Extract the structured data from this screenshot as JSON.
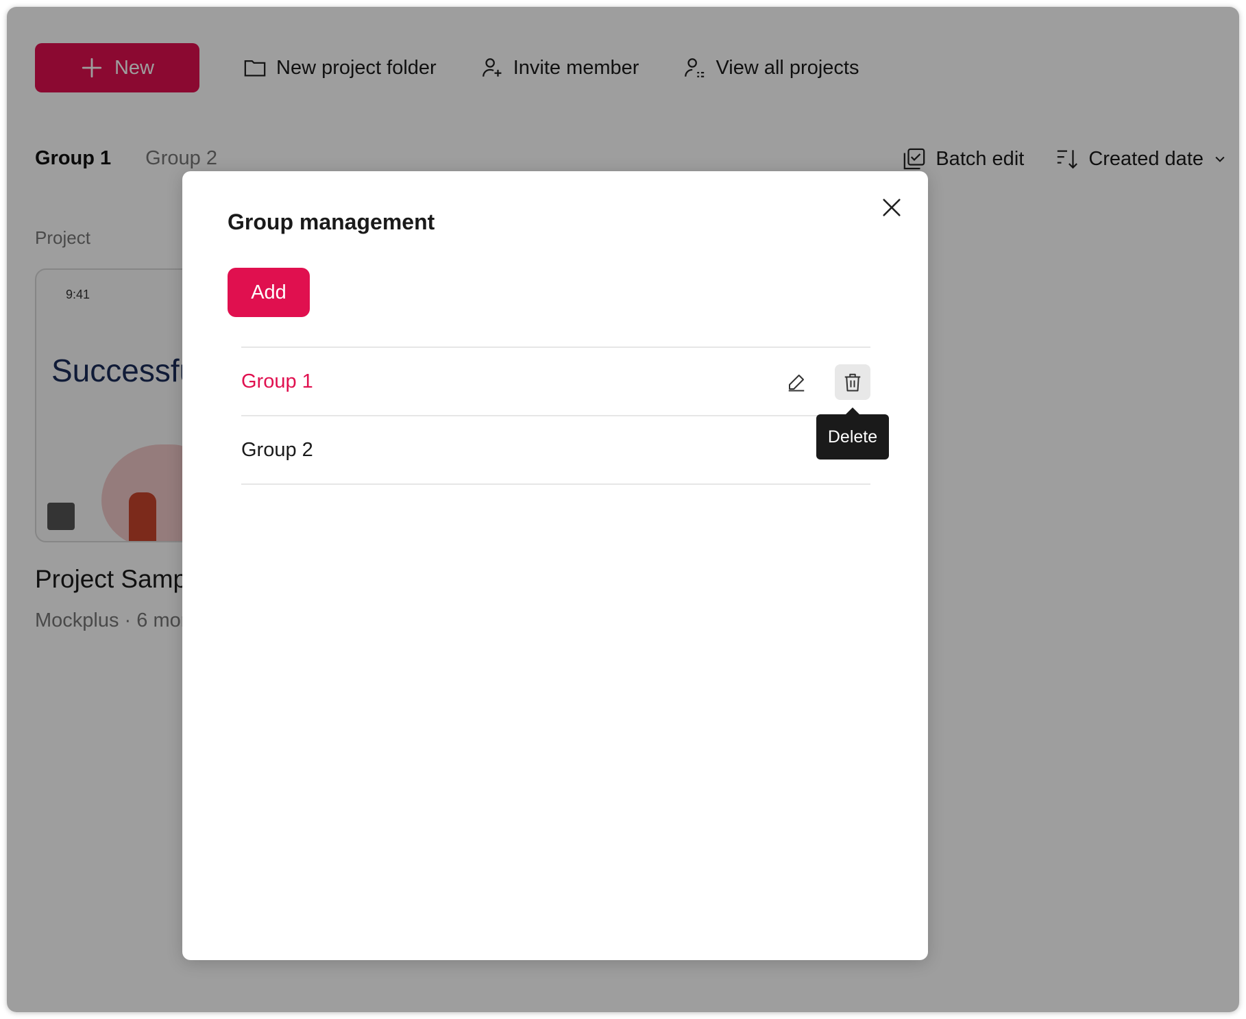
{
  "colors": {
    "accent": "#e0104f",
    "overlay": "rgba(0,0,0,0.38)",
    "tooltip_bg": "#1a1a1a"
  },
  "toolbar": {
    "new_label": "New",
    "items": [
      {
        "label": "New project folder",
        "icon": "folder-icon"
      },
      {
        "label": "Invite member",
        "icon": "user-add-icon"
      },
      {
        "label": "View all projects",
        "icon": "user-list-icon"
      }
    ]
  },
  "tabs": [
    {
      "label": "Group 1",
      "active": true
    },
    {
      "label": "Group 2",
      "active": false
    }
  ],
  "right_tools": {
    "batch_edit": "Batch edit",
    "sort_label": "Created date"
  },
  "section_label": "Project",
  "card": {
    "time": "9:41",
    "hero_text": "Successfu",
    "title": "Project Samp",
    "meta": "Mockplus · 6 mor"
  },
  "modal": {
    "title": "Group management",
    "add_label": "Add",
    "groups": [
      {
        "label": "Group 1",
        "active": true
      },
      {
        "label": "Group 2",
        "active": false
      }
    ],
    "tooltip": "Delete"
  }
}
